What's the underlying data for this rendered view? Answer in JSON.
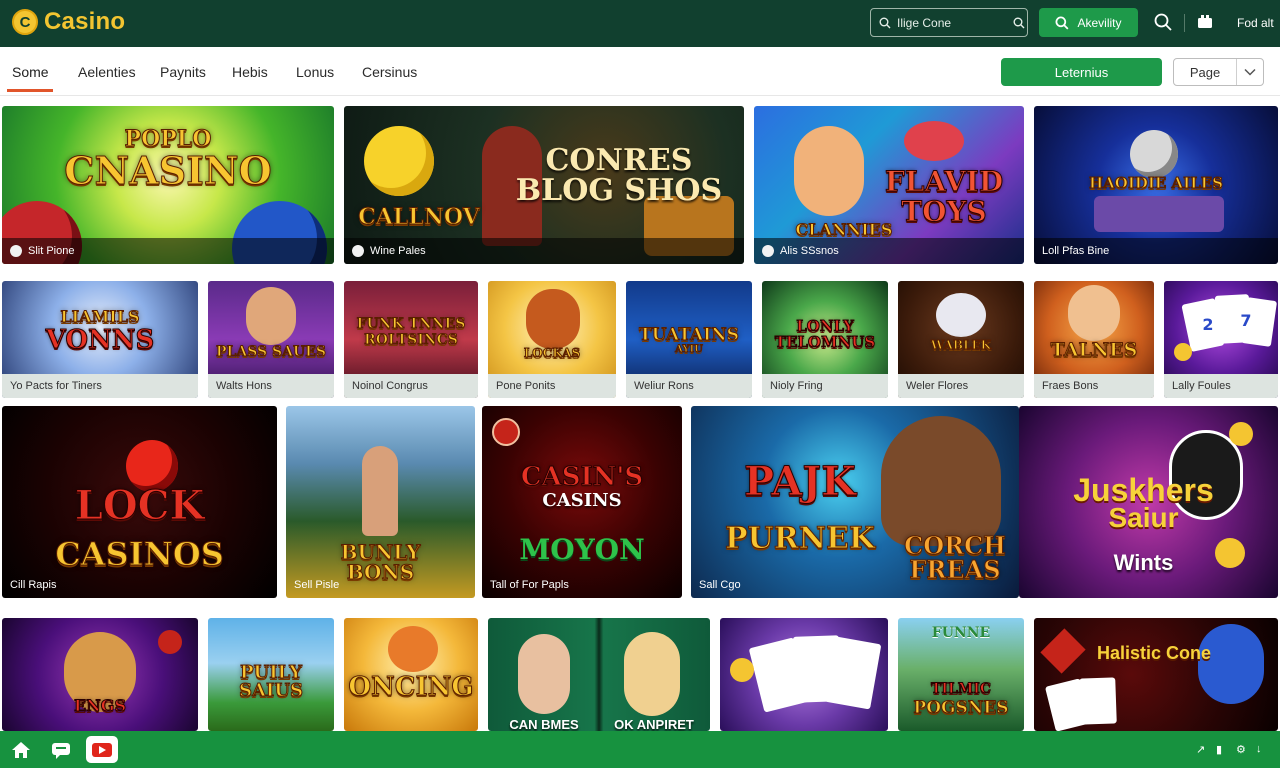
{
  "header": {
    "logo_text": "Casino",
    "logo_mark": "C",
    "search_value": "Ilige Cone",
    "search_icon": "search-icon",
    "action_button_label": "Akevility",
    "right_text": "Fod alt"
  },
  "nav": {
    "tabs": [
      "Some",
      "Aelenties",
      "Paynits",
      "Hebis",
      "Lonus",
      "Cersinus"
    ],
    "active_tab": "Some",
    "cta_label": "Leternius",
    "page_select_label": "Page"
  },
  "rows": {
    "row1": [
      "Slit Pione",
      "Wine Pales",
      "Alis SSsnos",
      "Loll Pfas Bine"
    ],
    "row2": [
      "Yo Pacts for Tiners",
      "Walts Hons",
      "Noinol Congrus",
      "Pone Ponits",
      "Weliur Rons",
      "Nioly Fring",
      "Weler Flores",
      "Fraes Bons",
      "Lally Foules"
    ],
    "row3": [
      "Cill Rapis",
      "Sell Pisle",
      "Tall of For Papls",
      "Sall Cgo"
    ],
    "row4": []
  },
  "titles": {
    "t1": [
      "POPLO",
      "CNASINO"
    ],
    "t2": [
      "CONRES",
      "BLOG SHOS",
      "CALLNOV"
    ],
    "t3": [
      "FLAVID",
      "TOYS",
      "CLANNIES"
    ],
    "t4": [
      "HAOIDIE AILES"
    ],
    "s1": [
      "LIAMILS",
      "VONNS"
    ],
    "s2": [
      "PLASS SAUES"
    ],
    "s3": [
      "FUNK TNNES",
      "ROLTSINCS"
    ],
    "s4": [
      "LOCKAS"
    ],
    "s5": [
      "TUATAINS",
      "AYIU"
    ],
    "s6": [
      "LONLY",
      "TELOMNUS"
    ],
    "s7": [
      "WABLEK"
    ],
    "s8": [
      "TALNES"
    ],
    "s9": [
      "2",
      "7"
    ],
    "b1": [
      "LOCK",
      "CASINOS"
    ],
    "b2": [
      "BUNLY",
      "BONS"
    ],
    "b3": [
      "CASIN'S",
      "CASINS",
      "MOYON"
    ],
    "b4": [
      "PAJK",
      "PURNEK",
      "CORCH",
      "FREAS"
    ],
    "b5": [
      "Juskhers",
      "Saiur",
      "Wints"
    ],
    "f1": [
      "ENGS"
    ],
    "f2": [
      "PUILY SAIUS"
    ],
    "f3": [
      "ONCING"
    ],
    "f4": [
      "CAN BMES",
      "OK ANPIRET"
    ],
    "f5": [],
    "f6": [
      "FUNNE",
      "TILMIC",
      "POGSNES"
    ],
    "f7": [
      "Halistic Cone"
    ]
  },
  "bottom": {
    "icons": [
      "home-icon",
      "chat-icon",
      "youtube-icon"
    ]
  },
  "colors": {
    "header_bg": "#11402f",
    "brand_gold": "#f3c531",
    "accent_green": "#1e9a4a",
    "bottom_green": "#17923f",
    "tab_underline": "#e1552b"
  }
}
